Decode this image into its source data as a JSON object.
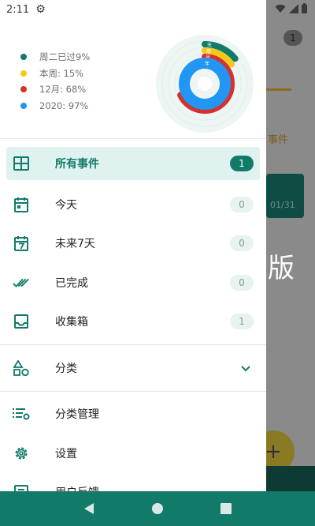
{
  "status_bar": {
    "time": "2:11"
  },
  "legend": [
    {
      "label": "周二已过9%",
      "color": "#117a69"
    },
    {
      "label": "本周: 15%",
      "color": "#f4c91c"
    },
    {
      "label": "12月: 68%",
      "color": "#d6302f"
    },
    {
      "label": "2020: 97%",
      "color": "#2196f3"
    }
  ],
  "rings": {
    "day": {
      "label": "天",
      "percent": 9,
      "color": "#117a69"
    },
    "week": {
      "label": "周",
      "percent": 15,
      "color": "#f4c91c"
    },
    "month": {
      "label": "月",
      "percent": 68,
      "color": "#d6302f"
    },
    "year": {
      "label": "年",
      "percent": 97,
      "color": "#2196f3"
    }
  },
  "menu": {
    "all_events": {
      "label": "所有事件",
      "count": "1"
    },
    "today": {
      "label": "今天",
      "count": "0"
    },
    "next7": {
      "label": "未来7天",
      "count": "0"
    },
    "completed": {
      "label": "已完成",
      "count": "0"
    },
    "inbox": {
      "label": "收集箱",
      "count": "1"
    },
    "category": {
      "label": "分类"
    },
    "category_manage": {
      "label": "分类管理"
    },
    "settings": {
      "label": "设置"
    },
    "feedback": {
      "label": "用户反馈"
    }
  },
  "background": {
    "badge": "1",
    "event_text": "事件",
    "date": "01/31",
    "big_text": "版",
    "fab": "+"
  },
  "colors": {
    "primary": "#117a69",
    "active_bg": "#e0f2ef"
  }
}
